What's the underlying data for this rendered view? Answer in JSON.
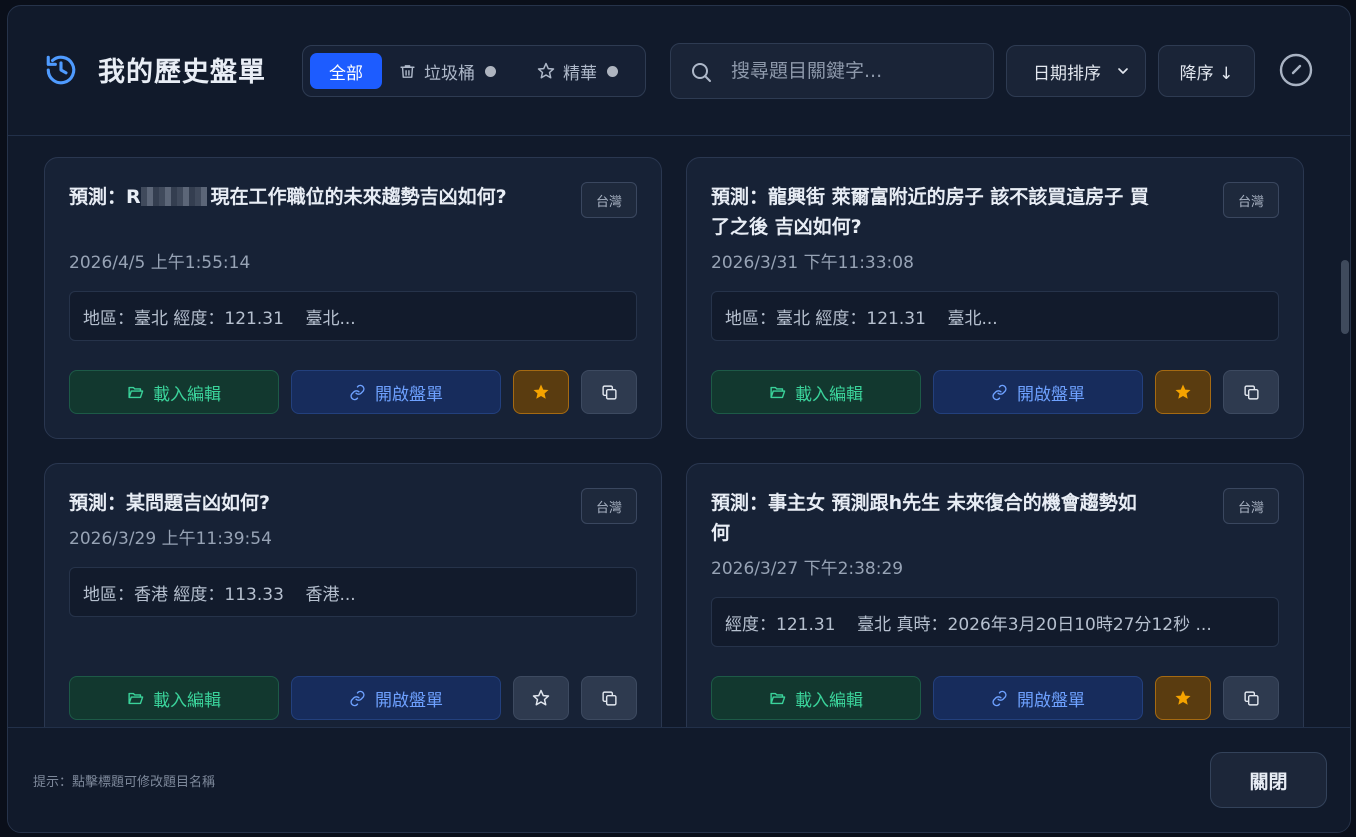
{
  "header": {
    "title": "我的歷史盤單",
    "filters": [
      {
        "label": "全部",
        "active": true,
        "icon": "none"
      },
      {
        "label": "垃圾桶",
        "active": false,
        "icon": "trash-icon"
      },
      {
        "label": "精華",
        "active": false,
        "icon": "star-icon"
      }
    ],
    "search_placeholder": "搜尋題目關鍵字...",
    "sort_select": "日期排序",
    "order_label": "降序 ↓"
  },
  "cards": [
    {
      "title_prefix": "預測：R",
      "title_rest": "現在工作職位的未來趨勢吉凶如何?",
      "tag": "台灣",
      "date": "2026/4/5 上午1:55:14",
      "info": "地區：臺北 經度：121.31    臺北...",
      "starred": true
    },
    {
      "title": "預測：龍興街 萊爾富附近的房子 該不該買這房子 買了之後 吉凶如何?",
      "tag": "台灣",
      "date": "2026/3/31 下午11:33:08",
      "info": "地區：臺北 經度：121.31    臺北...",
      "starred": true
    },
    {
      "title": "預測：某問題吉凶如何?",
      "tag": "台灣",
      "date": "2026/3/29 上午11:39:54",
      "info": "地區：香港 經度：113.33    香港...",
      "starred": false
    },
    {
      "title": "預測：事主女 預測跟h先生 未來復合的機會趨勢如何",
      "tag": "台灣",
      "date": "2026/3/27 下午2:38:29",
      "info": "經度：121.31    臺北 真時：2026年3月20日10時27分12秒 ...",
      "starred": true
    }
  ],
  "actions": {
    "load_label": "載入編輯",
    "open_label": "開啟盤單"
  },
  "footer": {
    "hint": "提示：點擊標題可修改題目名稱",
    "close_label": "關閉"
  },
  "colors": {
    "accent": "#1d5cff",
    "load": "#3ad29a",
    "open": "#6ea1ff",
    "star": "#f5a300"
  }
}
